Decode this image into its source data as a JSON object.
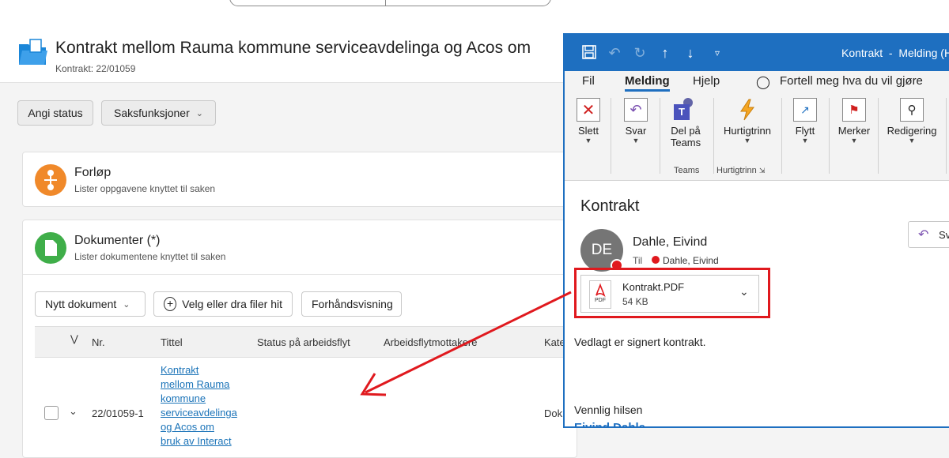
{
  "case": {
    "title": "Kontrakt mellom Rauma kommune serviceavdelinga og Acos om",
    "subtitle": "Kontrakt: 22/01059",
    "buttons": {
      "set_status": "Angi status",
      "case_functions": "Saksfunksjoner"
    }
  },
  "flow": {
    "title": "Forløp",
    "subtitle": "Lister oppgavene knyttet til saken"
  },
  "documents": {
    "title": "Dokumenter (*)",
    "subtitle": "Lister dokumentene knyttet til saken",
    "new_doc": "Nytt dokument",
    "upload": "Velg eller dra filer hit",
    "preview": "Forhåndsvisning",
    "columns": {
      "nr": "Nr.",
      "title": "Tittel",
      "status": "Status på arbeidsflyt",
      "recipients": "Arbeidsflytmottakere",
      "category": "Kate"
    },
    "row": {
      "nr": "22/01059-1",
      "title_lines": [
        "Kontrakt",
        "mellom Rauma",
        "kommune",
        "serviceavdelinga",
        "og Acos om",
        "bruk av Interact"
      ],
      "category": "Dok"
    }
  },
  "outlook": {
    "title": "Kontrakt  -  Melding (H",
    "menu": {
      "file": "Fil",
      "message": "Melding",
      "help": "Hjelp",
      "tell_me": "Fortell meg hva du vil gjøre"
    },
    "ribbon": {
      "delete": "Slett",
      "reply": "Svar",
      "teams_line1": "Del på",
      "teams_line2": "Teams",
      "quicksteps": "Hurtigtrinn",
      "move": "Flytt",
      "tags": "Merker",
      "editing": "Redigering",
      "group_teams": "Teams",
      "group_quicksteps": "Hurtigtrinn"
    },
    "subject": "Kontrakt",
    "sender": "Dahle, Eivind",
    "initials": "DE",
    "to_label": "Til",
    "to_name": "Dahle, Eivind",
    "reply_button": "Sv",
    "attachment": {
      "name": "Kontrakt.PDF",
      "size": "54 KB",
      "type_label": "PDF"
    },
    "body": "Vedlagt er signert kontrakt.",
    "greeting": "Vennlig hilsen",
    "signature_partial": "Eivind Dahle"
  },
  "colors": {
    "outlook_blue": "#1e6fc0",
    "highlight_red": "#e0191e",
    "link_blue": "#1a73b8",
    "flow_orange": "#f0892a",
    "docs_green": "#3fae49"
  }
}
